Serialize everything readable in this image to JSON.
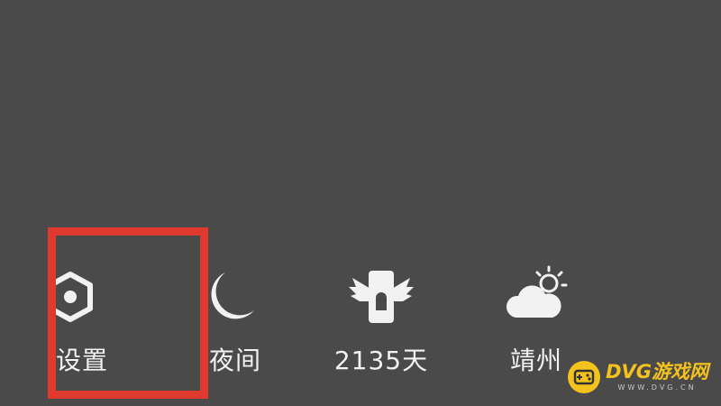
{
  "menu": {
    "items": [
      {
        "label": "设置",
        "icon": "settings-gear-icon"
      },
      {
        "label": "夜间",
        "icon": "moon-icon"
      },
      {
        "label": "2135天",
        "icon": "winged-badge-icon"
      },
      {
        "label": "靖州",
        "icon": "weather-cloud-sun-icon"
      }
    ]
  },
  "highlight": {
    "color": "#e03a2f"
  },
  "watermark": {
    "title": "DVG游戏网",
    "subtitle": "WWW.DVG.CN",
    "accent": "#f4c21c"
  },
  "colors": {
    "background": "#4a4a4a",
    "foreground": "#f2f2f2"
  }
}
